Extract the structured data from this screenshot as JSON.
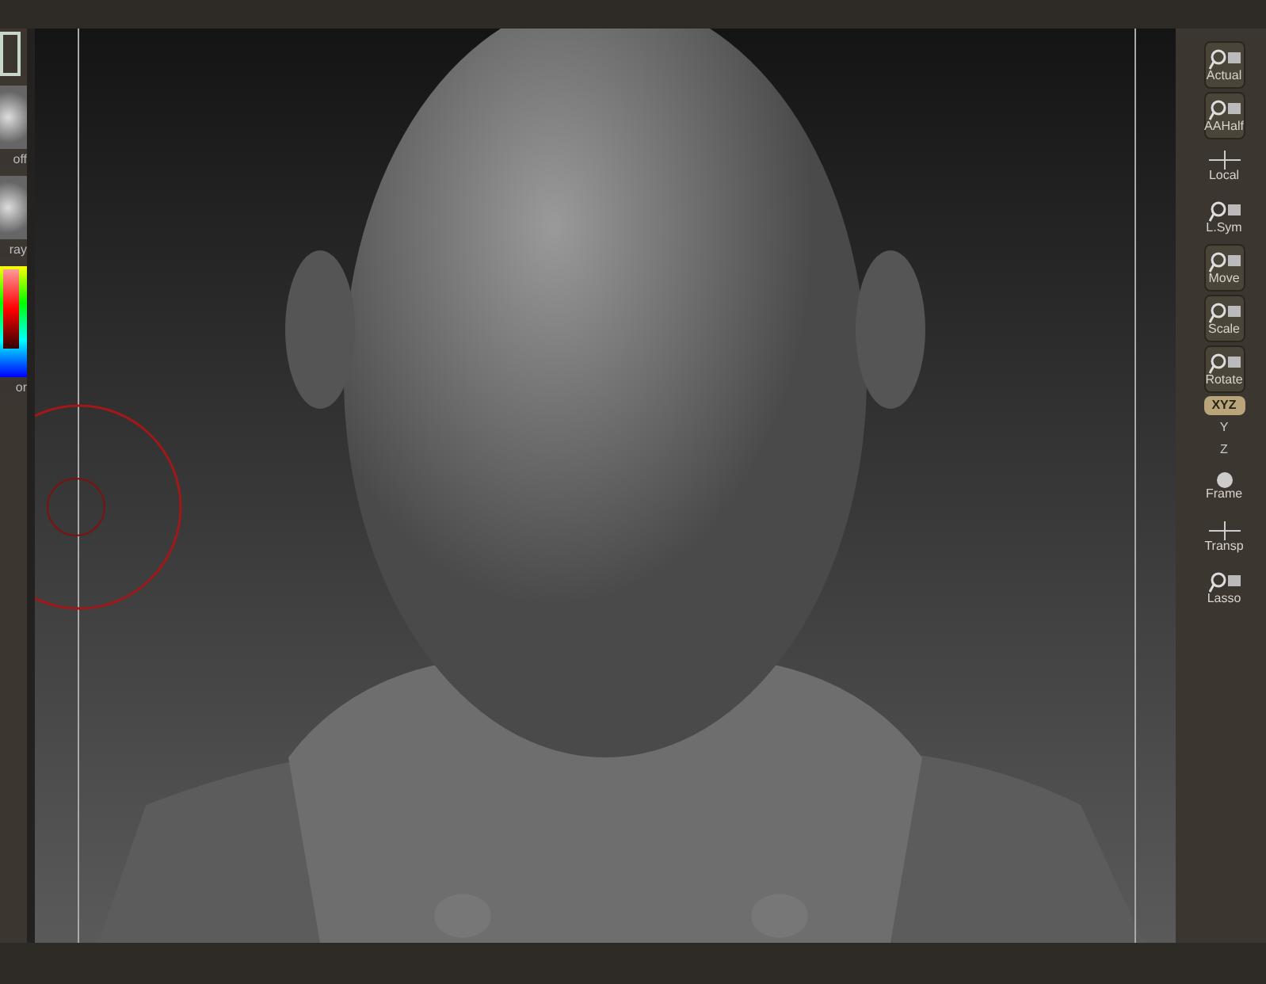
{
  "left_panel": {
    "items": [
      {
        "kind": "swatch"
      },
      {
        "kind": "sphere",
        "label": "off"
      },
      {
        "kind": "sphere",
        "label": "ray"
      },
      {
        "kind": "color",
        "label": "or"
      }
    ]
  },
  "right_toolbar": {
    "items": [
      {
        "kind": "button",
        "label": "Actual"
      },
      {
        "kind": "button",
        "label": "AAHalf"
      },
      {
        "kind": "plain",
        "label": "Local"
      },
      {
        "kind": "plain",
        "label": "L.Sym"
      },
      {
        "kind": "button",
        "label": "Move"
      },
      {
        "kind": "button",
        "label": "Scale"
      },
      {
        "kind": "button",
        "label": "Rotate"
      },
      {
        "kind": "toggle",
        "label": "XYZ",
        "on": true
      },
      {
        "kind": "small",
        "label": "Y"
      },
      {
        "kind": "small",
        "label": "Z"
      },
      {
        "kind": "plain",
        "label": "Frame"
      },
      {
        "kind": "plain",
        "label": "Transp"
      },
      {
        "kind": "plain",
        "label": "Lasso"
      }
    ]
  }
}
